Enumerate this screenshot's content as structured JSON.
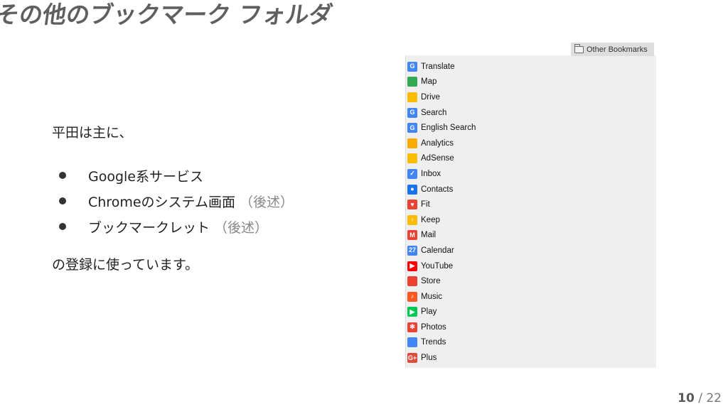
{
  "slide": {
    "title": "その他のブックマーク フォルダ",
    "intro": "平田は主に、",
    "bullets": [
      {
        "text": "Google系サービス",
        "note": ""
      },
      {
        "text": "Chromeのシステム画面",
        "note": "（後述）"
      },
      {
        "text": "ブックマークレット",
        "note": "（後述）"
      }
    ],
    "outro": "の登録に使っています。"
  },
  "bookmarks": {
    "folder_label": "Other Bookmarks",
    "items": [
      {
        "label": "Translate",
        "icon": "translate-icon",
        "glyph": "G",
        "color": "#4285f4"
      },
      {
        "label": "Map",
        "icon": "map-icon",
        "glyph": "",
        "color": "#34a853"
      },
      {
        "label": "Drive",
        "icon": "drive-icon",
        "glyph": "",
        "color": "#fbbc04"
      },
      {
        "label": "Search",
        "icon": "google-search-icon",
        "glyph": "G",
        "color": "#4285f4"
      },
      {
        "label": "English Search",
        "icon": "google-search-icon",
        "glyph": "G",
        "color": "#4285f4"
      },
      {
        "label": "Analytics",
        "icon": "analytics-icon",
        "glyph": "",
        "color": "#f9ab00"
      },
      {
        "label": "AdSense",
        "icon": "adsense-icon",
        "glyph": "",
        "color": "#fbbc04"
      },
      {
        "label": "Inbox",
        "icon": "inbox-icon",
        "glyph": "✓",
        "color": "#4285f4"
      },
      {
        "label": "Contacts",
        "icon": "contacts-icon",
        "glyph": "●",
        "color": "#1a73e8"
      },
      {
        "label": "Fit",
        "icon": "fit-icon",
        "glyph": "♥",
        "color": "#ea4335"
      },
      {
        "label": "Keep",
        "icon": "keep-icon",
        "glyph": "♀",
        "color": "#fbbc04"
      },
      {
        "label": "Mail",
        "icon": "mail-icon",
        "glyph": "M",
        "color": "#ea4335"
      },
      {
        "label": "Calendar",
        "icon": "calendar-icon",
        "glyph": "27",
        "color": "#4285f4"
      },
      {
        "label": "YouTube",
        "icon": "youtube-icon",
        "glyph": "▶",
        "color": "#ff0000"
      },
      {
        "label": "Store",
        "icon": "store-icon",
        "glyph": "",
        "color": "#ea4335"
      },
      {
        "label": "Music",
        "icon": "music-icon",
        "glyph": "♪",
        "color": "#ff5722"
      },
      {
        "label": "Play",
        "icon": "play-icon",
        "glyph": "▶",
        "color": "#00c853"
      },
      {
        "label": "Photos",
        "icon": "photos-icon",
        "glyph": "✻",
        "color": "#ea4335"
      },
      {
        "label": "Trends",
        "icon": "trends-icon",
        "glyph": "",
        "color": "#4285f4"
      },
      {
        "label": "Plus",
        "icon": "google-plus-icon",
        "glyph": "G+",
        "color": "#dd4b39"
      }
    ]
  },
  "page": {
    "current": "10",
    "separator": " / ",
    "total": "22"
  }
}
